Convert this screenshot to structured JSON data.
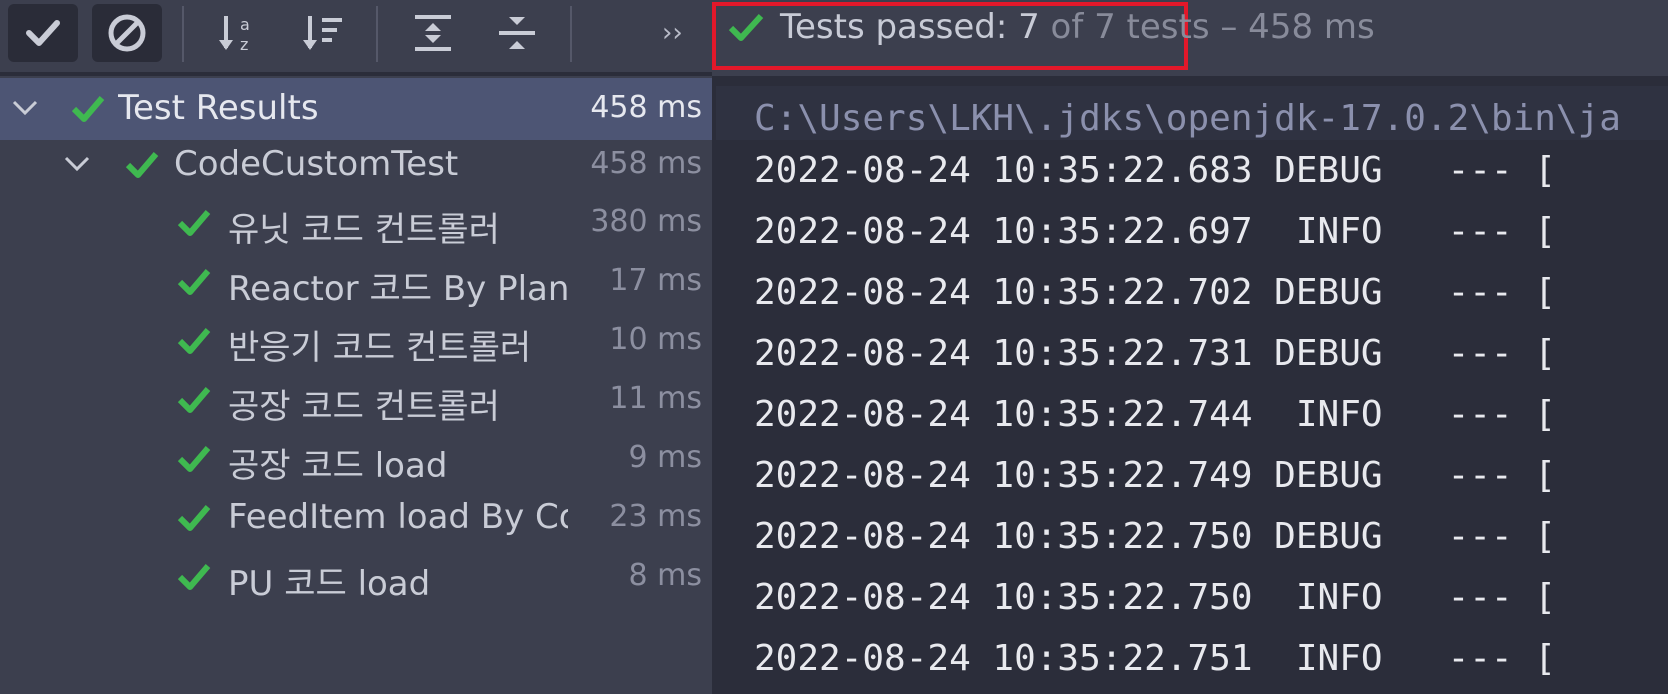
{
  "toolbar": {
    "buttons": [
      {
        "name": "show-passed",
        "icon": "check-icon"
      },
      {
        "name": "show-ignored",
        "icon": "ignore-icon"
      },
      {
        "name": "sort-alpha",
        "icon": "sort-alpha-icon"
      },
      {
        "name": "sort-duration",
        "icon": "sort-duration-icon"
      },
      {
        "name": "expand-all",
        "icon": "expand-all-icon"
      },
      {
        "name": "collapse-all",
        "icon": "collapse-all-icon"
      }
    ],
    "more_label": "››"
  },
  "status": {
    "passed_label": "Tests passed: 7",
    "of_label": "of 7 tests",
    "duration_label": "– 458 ms",
    "colors": {
      "check": "#3fb950",
      "highlight_box": "#e3182a"
    }
  },
  "tree": {
    "root": {
      "label": "Test Results",
      "time": "458 ms"
    },
    "suite": {
      "label": "CodeCustomTest",
      "time": "458 ms"
    },
    "tests": [
      {
        "label": "유닛 코드 컨트롤러",
        "time": "380 ms"
      },
      {
        "label": "Reactor 코드 By Plant a",
        "time": "17 ms"
      },
      {
        "label": "반응기 코드 컨트롤러",
        "time": "10 ms"
      },
      {
        "label": "공장 코드 컨트롤러",
        "time": "11 ms"
      },
      {
        "label": "공장 코드 load",
        "time": "9 ms"
      },
      {
        "label": "FeedItem load By Code",
        "time": "23 ms"
      },
      {
        "label": "PU 코드 load",
        "time": "8 ms"
      }
    ]
  },
  "console": {
    "command": "C:\\Users\\LKH\\.jdks\\openjdk-17.0.2\\bin\\ja",
    "lines": [
      "2022-08-24 10:35:22.683 DEBUG   --- [",
      "2022-08-24 10:35:22.697  INFO   --- [",
      "2022-08-24 10:35:22.702 DEBUG   --- [",
      "2022-08-24 10:35:22.731 DEBUG   --- [",
      "2022-08-24 10:35:22.744  INFO   --- [",
      "2022-08-24 10:35:22.749 DEBUG   --- [",
      "2022-08-24 10:35:22.750 DEBUG   --- [",
      "2022-08-24 10:35:22.750  INFO   --- [",
      "2022-08-24 10:35:22.751  INFO   --- ["
    ]
  }
}
